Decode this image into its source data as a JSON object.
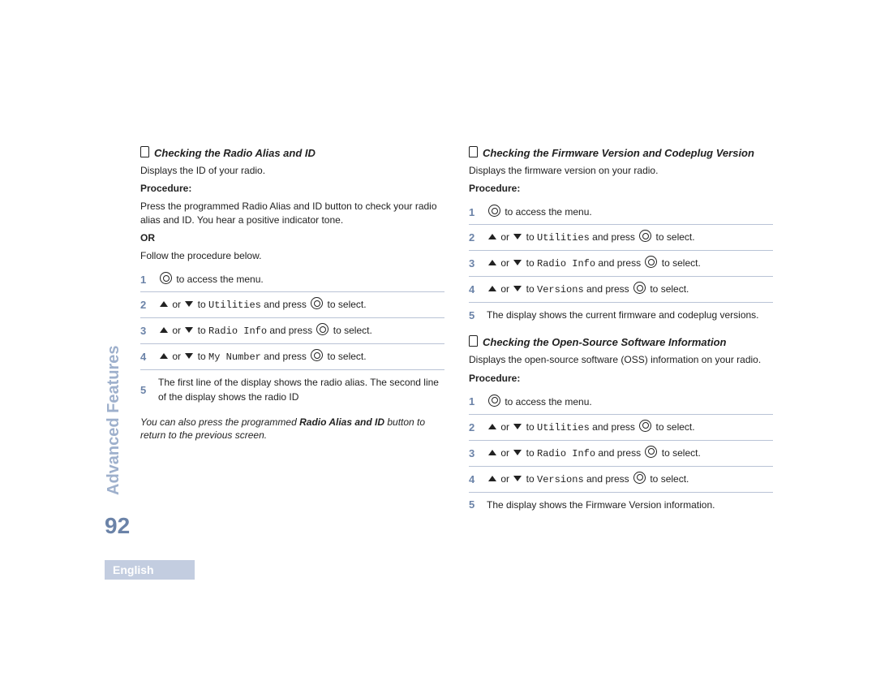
{
  "side_label": "Advanced Features",
  "page_number": "92",
  "language": "English",
  "left": {
    "title": "Checking the Radio Alias and ID",
    "intro": "Displays the ID of your radio.",
    "procedure_label": "Procedure:",
    "press_text": "Press the programmed Radio Alias and ID button to check your radio alias and ID. You hear a positive indicator tone.",
    "or_label": "OR",
    "follow": "Follow the procedure below.",
    "steps": {
      "1": " to access the menu.",
      "2_pre": " or ",
      "2_mid": " to ",
      "2_menu": "Utilities",
      "2_post": " and press ",
      "2_end": " to select.",
      "3_menu": "Radio Info",
      "4_menu": "My Number",
      "5": "The first line of the display shows the radio alias. The second line of the display shows the radio ID"
    },
    "note_pre": "You can also press the programmed ",
    "note_bold": "Radio Alias and ID",
    "note_post": " button to return to the previous screen."
  },
  "right1": {
    "title": "Checking the Firmware Version and Codeplug Version",
    "intro": "Displays the firmware version on your radio.",
    "procedure_label": "Procedure:",
    "steps": {
      "1": " to access the menu.",
      "2_menu": "Utilities",
      "3_menu": "Radio Info",
      "4_menu": "Versions",
      "5": "The display shows the current firmware and codeplug versions."
    }
  },
  "right2": {
    "title": "Checking the Open-Source Software Information",
    "intro": "Displays the open-source software (OSS) information on your radio.",
    "procedure_label": "Procedure:",
    "steps": {
      "1": " to access the menu.",
      "2_menu": "Utilities",
      "3_menu": "Radio Info",
      "4_menu": "Versions",
      "5": "The display shows the Firmware Version information."
    }
  },
  "common": {
    "or": " or ",
    "to": " to ",
    "and_press": " and press ",
    "to_select": " to select."
  }
}
